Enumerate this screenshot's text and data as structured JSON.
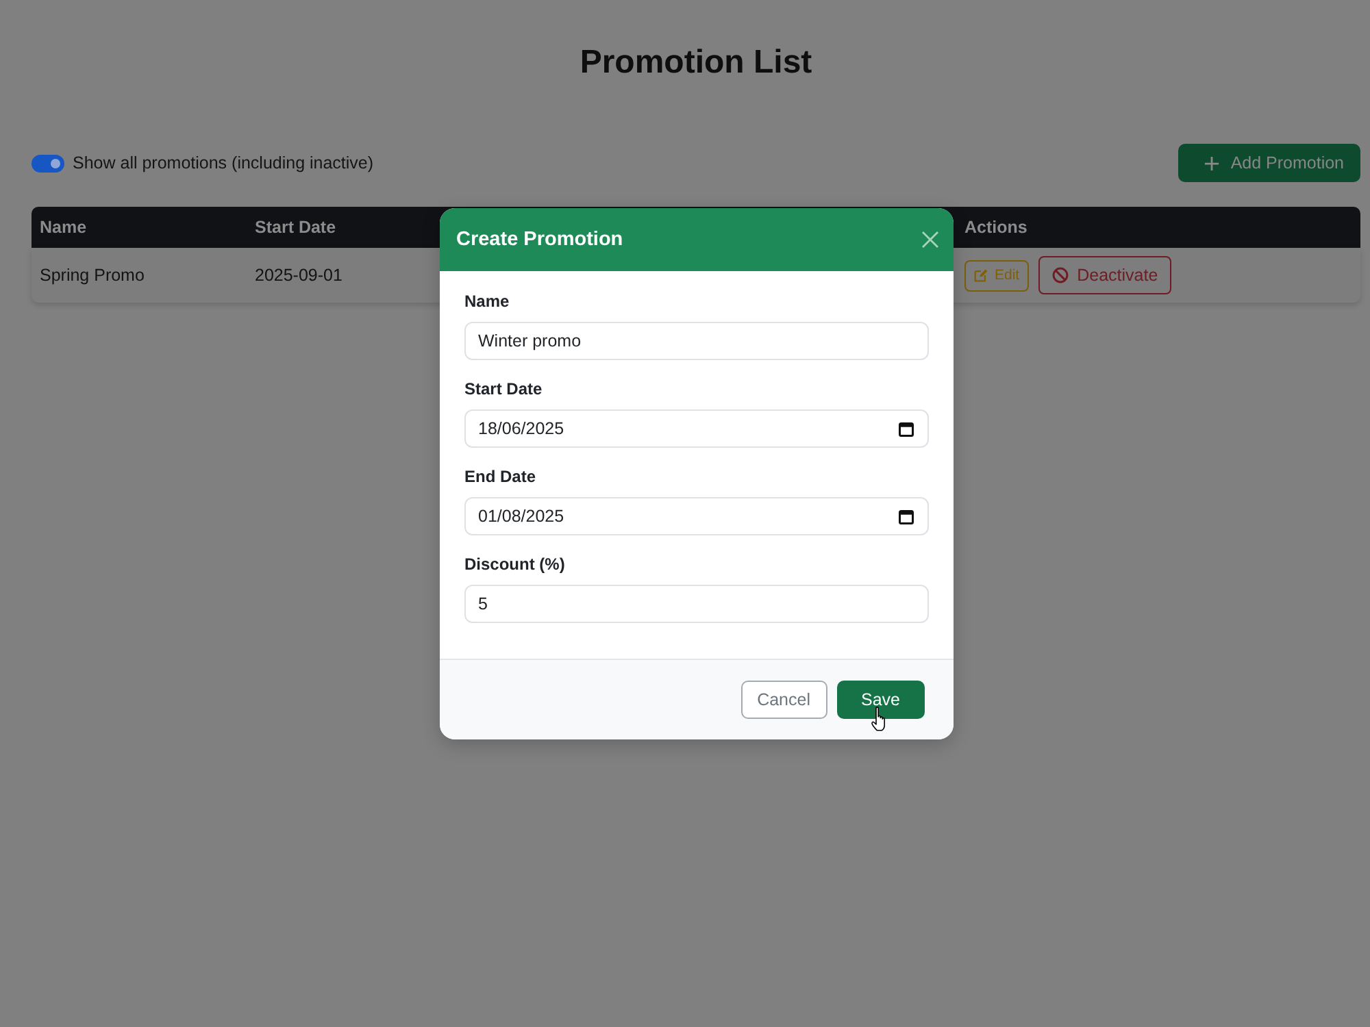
{
  "page": {
    "title": "Promotion List"
  },
  "toolbar": {
    "show_all_toggle": {
      "label": "Show all promotions (including inactive)",
      "on": true
    },
    "add_button": {
      "label": "Add Promotion"
    }
  },
  "table": {
    "columns": [
      "Name",
      "Start Date",
      "Actions"
    ],
    "rows": [
      {
        "name": "Spring Promo",
        "start_date": "2025-09-01",
        "actions": [
          {
            "kind": "edit",
            "label": "Edit"
          },
          {
            "kind": "deactivate",
            "label": "Deactivate"
          }
        ]
      }
    ]
  },
  "modal": {
    "title": "Create Promotion",
    "fields": [
      {
        "label": "Name",
        "kind": "text",
        "value": "Winter promo"
      },
      {
        "label": "Start Date",
        "kind": "date",
        "value": "18/06/2025"
      },
      {
        "label": "End Date",
        "kind": "date",
        "value": "01/08/2025"
      },
      {
        "label": "Discount (%)",
        "kind": "number",
        "value": "5"
      }
    ],
    "buttons": [
      {
        "kind": "cancel",
        "label": "Cancel",
        "hovered": false
      },
      {
        "kind": "save",
        "label": "Save",
        "hovered": true
      }
    ]
  }
}
